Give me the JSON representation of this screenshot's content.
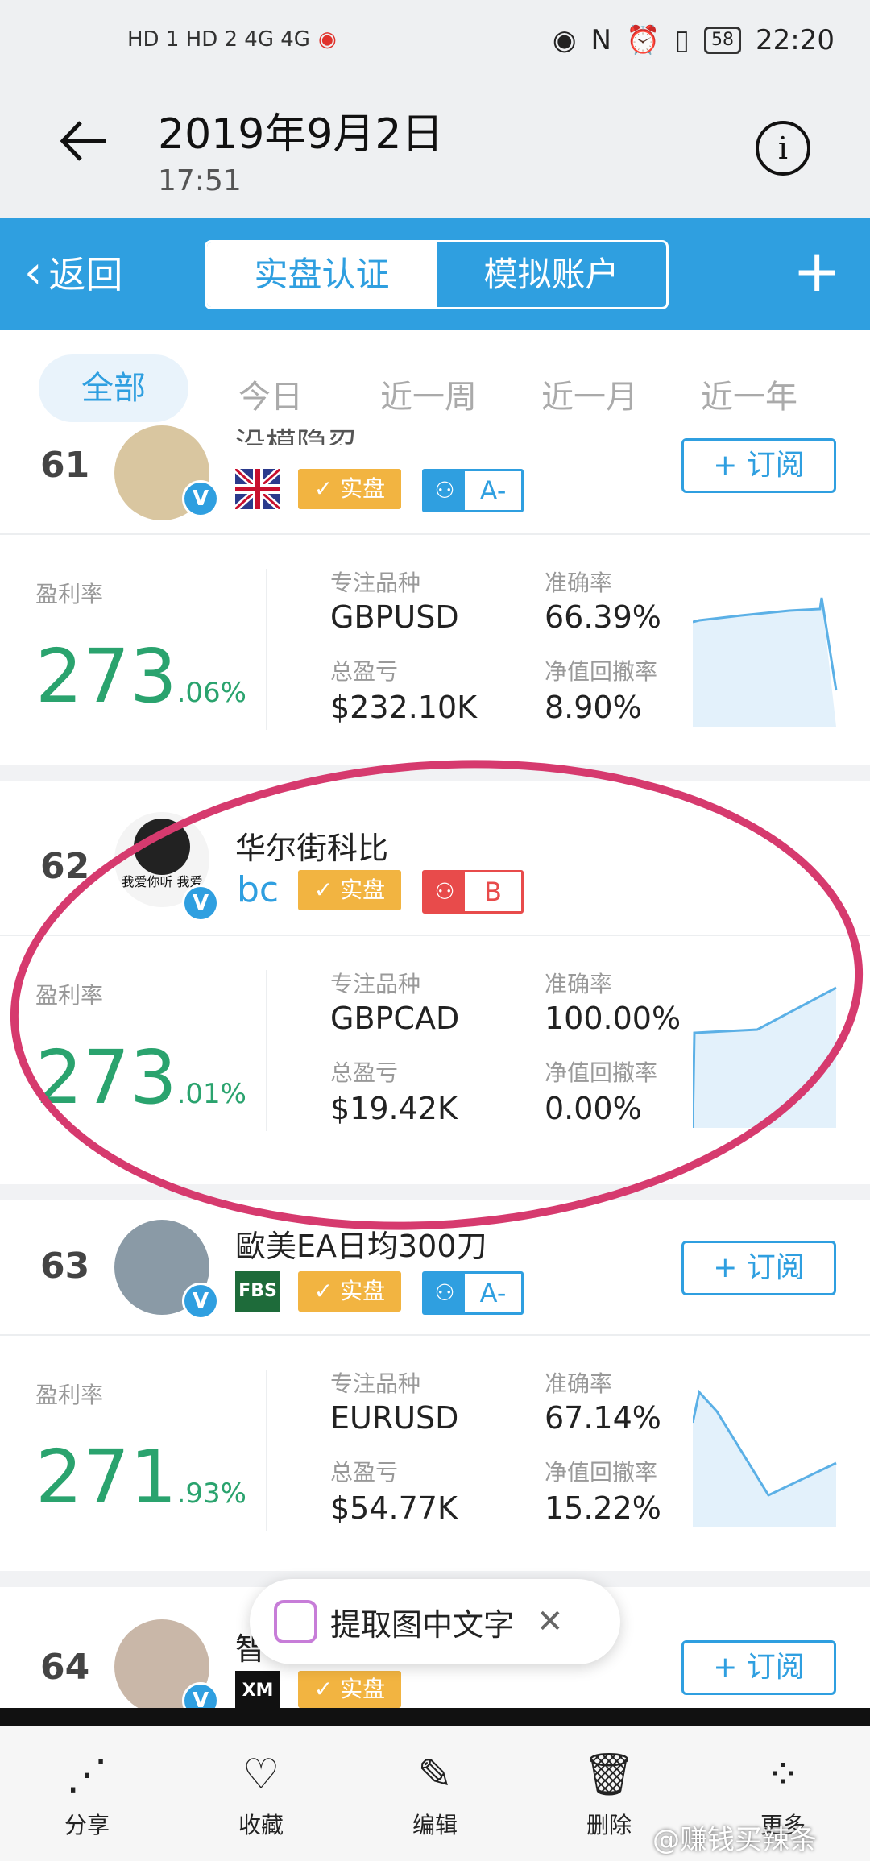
{
  "status": {
    "left": "HD 1 HD 2 4G 4G",
    "time": "22:20",
    "battery": "58"
  },
  "photo_header": {
    "date": "2019年9月2日",
    "time": "17:51"
  },
  "app_header": {
    "back_label": "返回",
    "tab_real": "实盘认证",
    "tab_demo": "模拟账户",
    "plus": "+"
  },
  "filters": [
    "全部",
    "今日",
    "近一周",
    "近一月",
    "近一年"
  ],
  "cards": [
    {
      "rank": "61",
      "name": "沿模隐忍",
      "shipan": "实盘",
      "grade": "A-",
      "subscribe": "+ 订阅",
      "profit_label": "盈利率",
      "profit_main": "273",
      "profit_dec": ".06%",
      "symbol_label": "专注品种",
      "symbol": "GBPUSD",
      "pnl_label": "总盈亏",
      "pnl": "$232.10K",
      "acc_label": "准确率",
      "acc": "66.39%",
      "dd_label": "净值回撤率",
      "dd": "8.90%"
    },
    {
      "rank": "62",
      "name": "华尔街科比",
      "broker": "bc",
      "shipan": "实盘",
      "grade": "B",
      "profit_label": "盈利率",
      "profit_main": "273",
      "profit_dec": ".01%",
      "symbol_label": "专注品种",
      "symbol": "GBPCAD",
      "pnl_label": "总盈亏",
      "pnl": "$19.42K",
      "acc_label": "准确率",
      "acc": "100.00%",
      "dd_label": "净值回撤率",
      "dd": "0.00%",
      "avatar_text": "我爱你听 我爱"
    },
    {
      "rank": "63",
      "name": "歐美EA日均300刀",
      "broker": "FBS",
      "shipan": "实盘",
      "grade": "A-",
      "subscribe": "+ 订阅",
      "profit_label": "盈利率",
      "profit_main": "271",
      "profit_dec": ".93%",
      "symbol_label": "专注品种",
      "symbol": "EURUSD",
      "pnl_label": "总盈亏",
      "pnl": "$54.77K",
      "acc_label": "准确率",
      "acc": "67.14%",
      "dd_label": "净值回撤率",
      "dd": "15.22%"
    },
    {
      "rank": "64",
      "name": "智",
      "broker": "XM",
      "shipan": "实盘",
      "subscribe": "+ 订阅"
    }
  ],
  "ocr_popup": {
    "label": "提取图中文字"
  },
  "bottom_bar": [
    "分享",
    "收藏",
    "编辑",
    "删除",
    "更多"
  ],
  "watermark": "@赚钱买辣条",
  "colors": {
    "brand": "#2f9fe0",
    "profit": "#2aa36e",
    "shipan": "#f2b441",
    "highlight": "#d63a6e"
  }
}
